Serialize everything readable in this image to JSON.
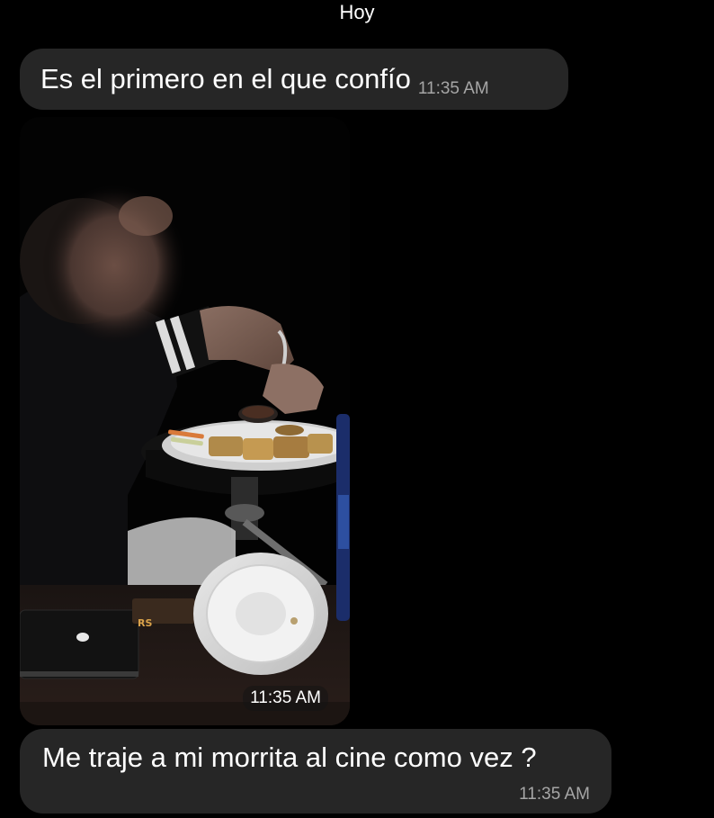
{
  "date_header": "Hoy",
  "messages": [
    {
      "type": "text",
      "text": "Es el primero en el que confío",
      "time": "11:35 AM"
    },
    {
      "type": "photo",
      "time": "11:35 AM"
    },
    {
      "type": "text",
      "text": "Me traje a mi morrita al cine como vez ?",
      "time": "11:35 AM"
    }
  ],
  "colors": {
    "background": "#000000",
    "bubble": "#262626",
    "text": "#ffffff",
    "timestamp": "#a6a6a6"
  }
}
